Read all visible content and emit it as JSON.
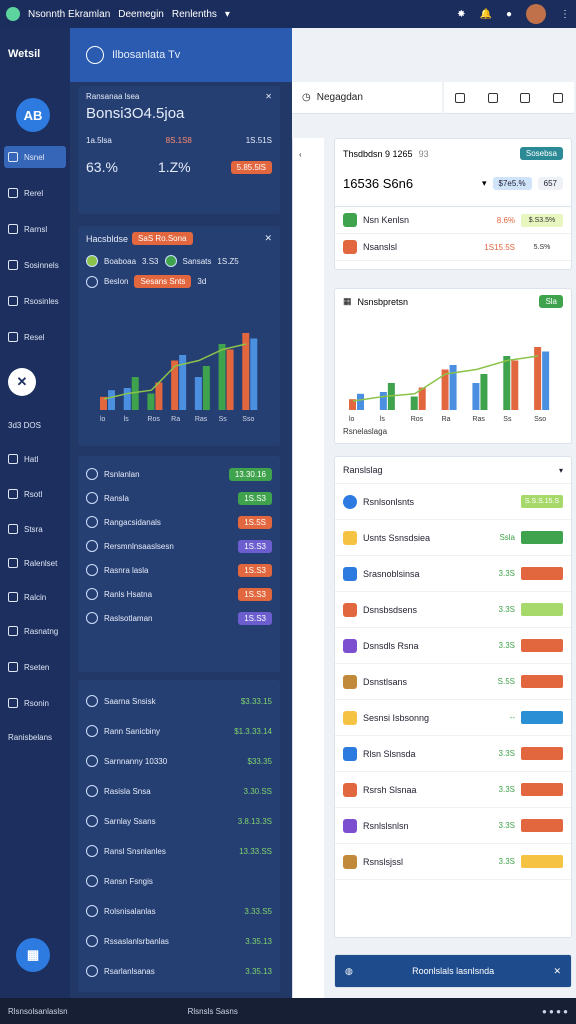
{
  "topbar": {
    "title": "Nsonnth Ekramlan",
    "menu1": "Deemegin",
    "menu2": "Renlenths"
  },
  "rail": {
    "brand": "Wetsil",
    "avatar_text": "AB",
    "items": [
      "Nsnel",
      "Rerel",
      "Rarnsl",
      "Sosinnels",
      "Rsosinles",
      "Resel"
    ],
    "section": "3d3 DOS",
    "items2": [
      "Hatl",
      "Rsotl",
      "Stsra",
      "Ralenlset",
      "Ralcin",
      "Rasnatng",
      "Rseten",
      "Rsonin",
      "Ranisbelans"
    ]
  },
  "mid": {
    "header": "Ilbosanlata Tv",
    "card1": {
      "label": "Ransanaa lsea",
      "title": "Bonsi3O4.5joa",
      "k1": "1a.5lsa",
      "k2": "8S.1S8",
      "k3": "1S.51S",
      "v1": "63.%",
      "v2": "1.Z%",
      "v3": "5.85.5lS",
      "badge_color": "#e2673f"
    },
    "card2": {
      "title": "Hacsbldse",
      "tag": "SaS Ro.Sona",
      "leg1": "Boaboaa",
      "leg1v": "3.S3",
      "leg2": "Sansats",
      "leg2v": "1S.Z5",
      "sub": "Beslon",
      "subtag": "Sesans Snts",
      "subv": "3d"
    },
    "list": [
      {
        "label": "Rsnlanlan",
        "val": "13.30.16",
        "color": "#3fa24c"
      },
      {
        "label": "Ransla",
        "val": "1S.S3",
        "color": "#3fa24c"
      },
      {
        "label": "Rangacsidanals",
        "val": "1S.5S",
        "color": "#e2673f"
      },
      {
        "label": "Rersmnlnsaaslsesn",
        "val": "1S.S3",
        "color": "#6c5ecf"
      },
      {
        "label": "Rasnra lasla",
        "val": "1S.S3",
        "color": "#e2673f"
      },
      {
        "label": "Ranls Hsatna",
        "val": "1S.S3",
        "color": "#e2673f"
      },
      {
        "label": "Raslsotlaman",
        "val": "1S.S3",
        "color": "#6c5ecf"
      }
    ],
    "list2": [
      {
        "label": "Saarna Snsisk",
        "val": "$3.33.15"
      },
      {
        "label": "Rann Sanicbiny",
        "val": "$1.3.33.14"
      },
      {
        "label": "Sarnnanny 10330",
        "val": "$33.35"
      },
      {
        "label": "Rasisla Snsa",
        "val": "3.30.SS"
      },
      {
        "label": "Sarnlay Ssans",
        "val": "3.8.13.3S"
      },
      {
        "label": "Ransl Snsnlanles",
        "val": "13.33.SS"
      },
      {
        "label": "Ransn Fsngis",
        "val": ""
      },
      {
        "label": "Rolsnisalanlas",
        "val": "3.33.S5"
      },
      {
        "label": "Rssaslanlsrbanlas",
        "val": "3.35.13"
      },
      {
        "label": "Rsarlanlsanas",
        "val": "3.35.13"
      }
    ]
  },
  "chart_data": {
    "type": "bar",
    "categories": [
      "lo",
      "ls",
      "Ros",
      "Ra",
      "Ras",
      "Ss",
      "Sso"
    ],
    "series": [
      {
        "name": "",
        "values": [
          12,
          20,
          15,
          45,
          30,
          60,
          70
        ]
      },
      {
        "name": "",
        "values": [
          18,
          30,
          25,
          50,
          40,
          55,
          65
        ]
      }
    ],
    "line": [
      10,
      15,
      18,
      40,
      45,
      55,
      60
    ],
    "ylim": [
      0,
      100
    ]
  },
  "header": {
    "title": "Negagdan"
  },
  "right": {
    "card1": {
      "title": "Thsdbdsn 9 1265",
      "sub": "93",
      "badge": "Sosebsa",
      "big": "16536 S6n6",
      "v1": "$7e5.%",
      "v2": "657"
    },
    "rows1": [
      {
        "label": "Nsn Kenlsn",
        "sub": "Lesns",
        "v": "8.6%",
        "b": "$.S3.5%",
        "c": "#e8f7c0"
      },
      {
        "label": "Nsanslsl",
        "sub": "Lesns",
        "v": "1S15.5S",
        "b": "5.S%",
        "c": "#fff"
      }
    ],
    "chart_title": "Nsnsbpretsn",
    "chart_tag": "Sla",
    "chart_foot": "Rsnelaslaga",
    "list_title": "Ranslslag",
    "list_head": "Rsnlsonlsnts",
    "list_head_sub": "Rsnoilsnlas",
    "list_head_badge": "S.S.S.15.S",
    "items": [
      {
        "label": "Usnts Ssnsdsiea",
        "sub": "Rsnsoshstns",
        "v": "Ssla",
        "c": "#3fa24c"
      },
      {
        "label": "Srasnoblsinsa",
        "sub": "",
        "v": "3.3S",
        "c": "#e2673f"
      },
      {
        "label": "Dsnsbsdsens",
        "sub": "",
        "v": "3.3S",
        "c": "#a6d96a"
      },
      {
        "label": "Dsnsdls Rsna",
        "sub": "",
        "v": "3.3S",
        "c": "#e2673f"
      },
      {
        "label": "Dsnstlsans",
        "sub": "Rsnsoshstns",
        "v": "S.5S",
        "c": "#e2673f"
      },
      {
        "label": "Sesnsi Isbsonng",
        "sub": "",
        "v": "--",
        "c": "#2a8fd4"
      },
      {
        "label": "Rlsn Slsnsda",
        "sub": "Rsnsoshstns",
        "v": "3.3S",
        "c": "#e2673f"
      },
      {
        "label": "Rsrsh Slsnaa",
        "sub": "Rsnsoshstns",
        "v": "3.3S",
        "c": "#e2673f"
      },
      {
        "label": "Rsnlslsnlsn",
        "sub": "Rsnsoshstns",
        "v": "3.3S",
        "c": "#e2673f"
      },
      {
        "label": "Rsnslsjssl",
        "sub": "Rsnsoshstns",
        "v": "3.3S",
        "c": "#f5c341"
      }
    ],
    "footer": "Roonlslals lasnlsnda"
  },
  "bottom": {
    "left": "Rlsnsolsanlaslsn",
    "center": "Rlsnsls Sasns"
  }
}
